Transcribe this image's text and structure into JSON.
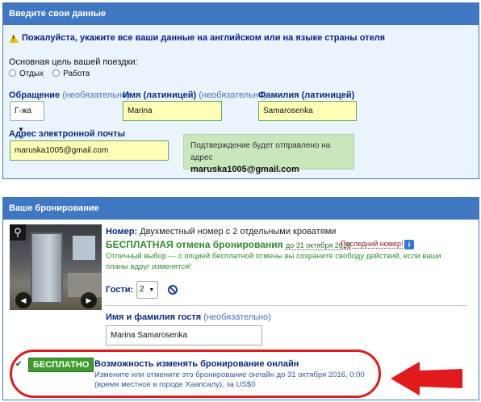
{
  "personal": {
    "header": "Введите свои данные",
    "warning": "Пожалуйста, укажите все ваши данные на английском или на языке страны отеля",
    "purpose_label": "Основная цель вашей поездки:",
    "purpose_options": [
      "Отдых",
      "Работа"
    ],
    "salutation_label": "Обращение",
    "salutation_optional": "(необязательно)",
    "salutation_value": "Г-жа",
    "first_name_label": "Имя (латиницей)",
    "first_name_optional": "(необязательно)",
    "first_name_value": "Marina",
    "last_name_label": "Фамилия (латиницей)",
    "last_name_value": "Samarosenka",
    "email_label": "Адрес электронной почты",
    "email_value": "maruska1005@gmail.com",
    "confirm_text": "Подтверждение будет отправлено на адрес",
    "confirm_email": "maruska1005@gmail.com"
  },
  "booking": {
    "header": "Ваше бронирование",
    "room_label": "Номер:",
    "room_name": "Двухместный номер с 2 отдельными кроватями",
    "free_cancel": "БЕСПЛАТНАЯ отмена бронирования",
    "free_cancel_date": "до 31 октября 2016",
    "last_room": "Последний номер!",
    "description": "Отличный выбор — с опцией бесплатной отмены вы сохраните свободу действий, если ваши планы вдруг изменятся!",
    "guests_label": "Гости:",
    "guests_value": "2",
    "guest_name_label": "Имя и фамилия гостя",
    "guest_name_optional": "(необязательно)",
    "guest_name_value": "Marina Samarosenka",
    "flex_badge": "БЕСПЛАТНО",
    "flex_title": "Возможность изменять бронирование онлайн",
    "flex_desc": "Измените или отмените это бронирование онлайн до 31 октября 2016, 0:00 (время местное в городе Хаапсалу), за US$0"
  },
  "icons": {
    "warning": "warning-icon",
    "zoom": "magnifier-icon",
    "prev": "arrow-left-icon",
    "next": "arrow-right-icon",
    "info": "info-icon",
    "no": "no-entry-icon",
    "arrow": "red-arrow-icon"
  },
  "colors": {
    "header_blue": "#3f78c0",
    "field_yellow": "#ffffb8",
    "confirm_green": "#c9e6bd",
    "free_green": "#2e8b2e",
    "annotation_red": "#e11b1b"
  }
}
